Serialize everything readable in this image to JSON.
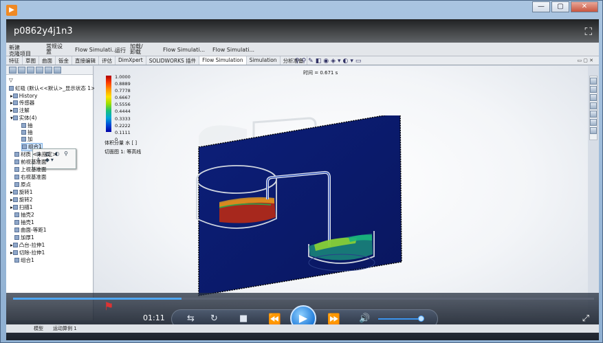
{
  "player": {
    "video_title": "p0862y4j1n3",
    "current_time": "01:11",
    "progress": 0.29,
    "volume": 0.8,
    "icons": [
      "app-logo-icon",
      "minimize-icon",
      "restore-icon",
      "close-icon",
      "fullscreen-icon",
      "repeat-icon",
      "refresh-icon",
      "stop-icon",
      "rewind-icon",
      "play-icon",
      "fast-forward-icon",
      "volume-icon",
      "expand-icon"
    ]
  },
  "ribbon": {
    "new_label": "新建",
    "clone_label": "克隆项目",
    "general_label": "常规设置",
    "flow_sim_1": "Flow Simulati...",
    "run_label": "运行",
    "load_unload": "加载/卸载",
    "flow_sim_2": "Flow Simulati...",
    "flow_sim_3": "Flow Simulati..."
  },
  "cmd_tabs": [
    "特征",
    "草图",
    "曲面",
    "钣金",
    "直接编辑",
    "评估",
    "DimXpert",
    "SOLIDWORKS 插件",
    "Flow Simulation",
    "Simulation",
    "分析准备"
  ],
  "active_tab": "Flow Simulation",
  "tree": {
    "root": "虹吸 (默认<<默认>_显示状态 1>)",
    "items": [
      "History",
      "传感器",
      "注解",
      "实体(4)",
      "材质 <未指定>",
      "前视基准面",
      "上视基准面",
      "右视基准面",
      "原点",
      "旋转1",
      "旋转2",
      "扫描1",
      "抽壳2",
      "抽壳1",
      "曲面-等距1",
      "加厚1",
      "凸台-拉伸1",
      "切除-拉伸1",
      "组合1"
    ],
    "solid_bodies": [
      "抽",
      "抽",
      "加"
    ],
    "selected": "组合1"
  },
  "legend": {
    "values": [
      "1.0000",
      "0.8889",
      "0.7778",
      "0.6667",
      "0.5556",
      "0.4444",
      "0.3333",
      "0.2222",
      "0.1111",
      "0"
    ],
    "quantity_label": "体积分量 水 [ ]",
    "cut_plot_label": "切面图 1: 等高线",
    "time_label": "时间 = 0.671 s",
    "colors": [
      "#b00000",
      "#ff3b00",
      "#ff9900",
      "#ffe100",
      "#9be000",
      "#18c07a",
      "#00a5d8",
      "#0048d6",
      "#0000a8"
    ]
  },
  "status": {
    "tab_model": "模型",
    "tab_motion": "运动算例 1"
  }
}
